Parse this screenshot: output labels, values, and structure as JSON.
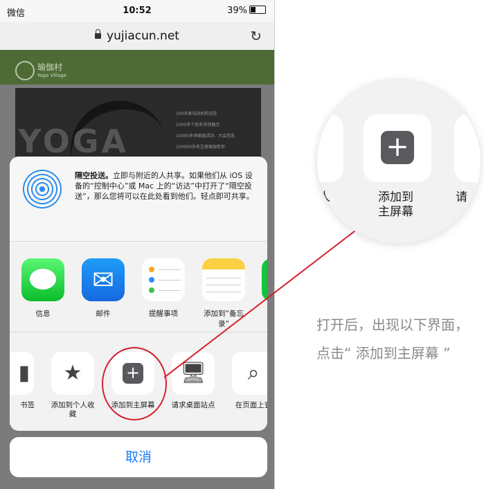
{
  "status": {
    "carrier": "微信",
    "time": "10:52",
    "battery": "39%"
  },
  "browser": {
    "url": "yujiacun.net"
  },
  "website": {
    "name": "瑜伽村",
    "sub": "Yoga Village",
    "banner_word": "YOGA",
    "lines": [
      "100多家培训机构进驻",
      "1000多个知名导师展示",
      "10000多场瑜伽活动、大会信息",
      "100000多名注册瑜伽老师"
    ]
  },
  "airdrop": {
    "title": "隔空投送。",
    "body": "立即与附近的人共享。如果他们从 iOS 设备的“控制中心”或 Mac 上的“访达”中打开了“隔空投送”，那么您将可以在此处看到他们。轻点即可共享。"
  },
  "apps": [
    {
      "label": "信息",
      "icon": "messages-icon"
    },
    {
      "label": "邮件",
      "icon": "mail-icon"
    },
    {
      "label": "提醒事项",
      "icon": "reminders-icon"
    },
    {
      "label": "添加到“备忘录”",
      "icon": "notes-icon"
    }
  ],
  "actions": [
    {
      "label": "书签",
      "icon": "bookmark-icon"
    },
    {
      "label": "添加到个人收藏",
      "icon": "star-icon"
    },
    {
      "label": "添加到主屏幕",
      "icon": "add-home-icon"
    },
    {
      "label": "请求桌面站点",
      "icon": "desktop-icon"
    },
    {
      "label": "在页面上查",
      "icon": "search-icon"
    }
  ],
  "cancel_label": "取消",
  "zoom": {
    "left_partial": "人",
    "label": "添加到主屏幕",
    "right_partial": "请"
  },
  "instruction": "打开后，出现以下界面，点击“ 添加到主屏幕 ”",
  "colors": {
    "accent": "#147efb",
    "highlight": "#d4202e",
    "site_green": "#4e6b36"
  }
}
